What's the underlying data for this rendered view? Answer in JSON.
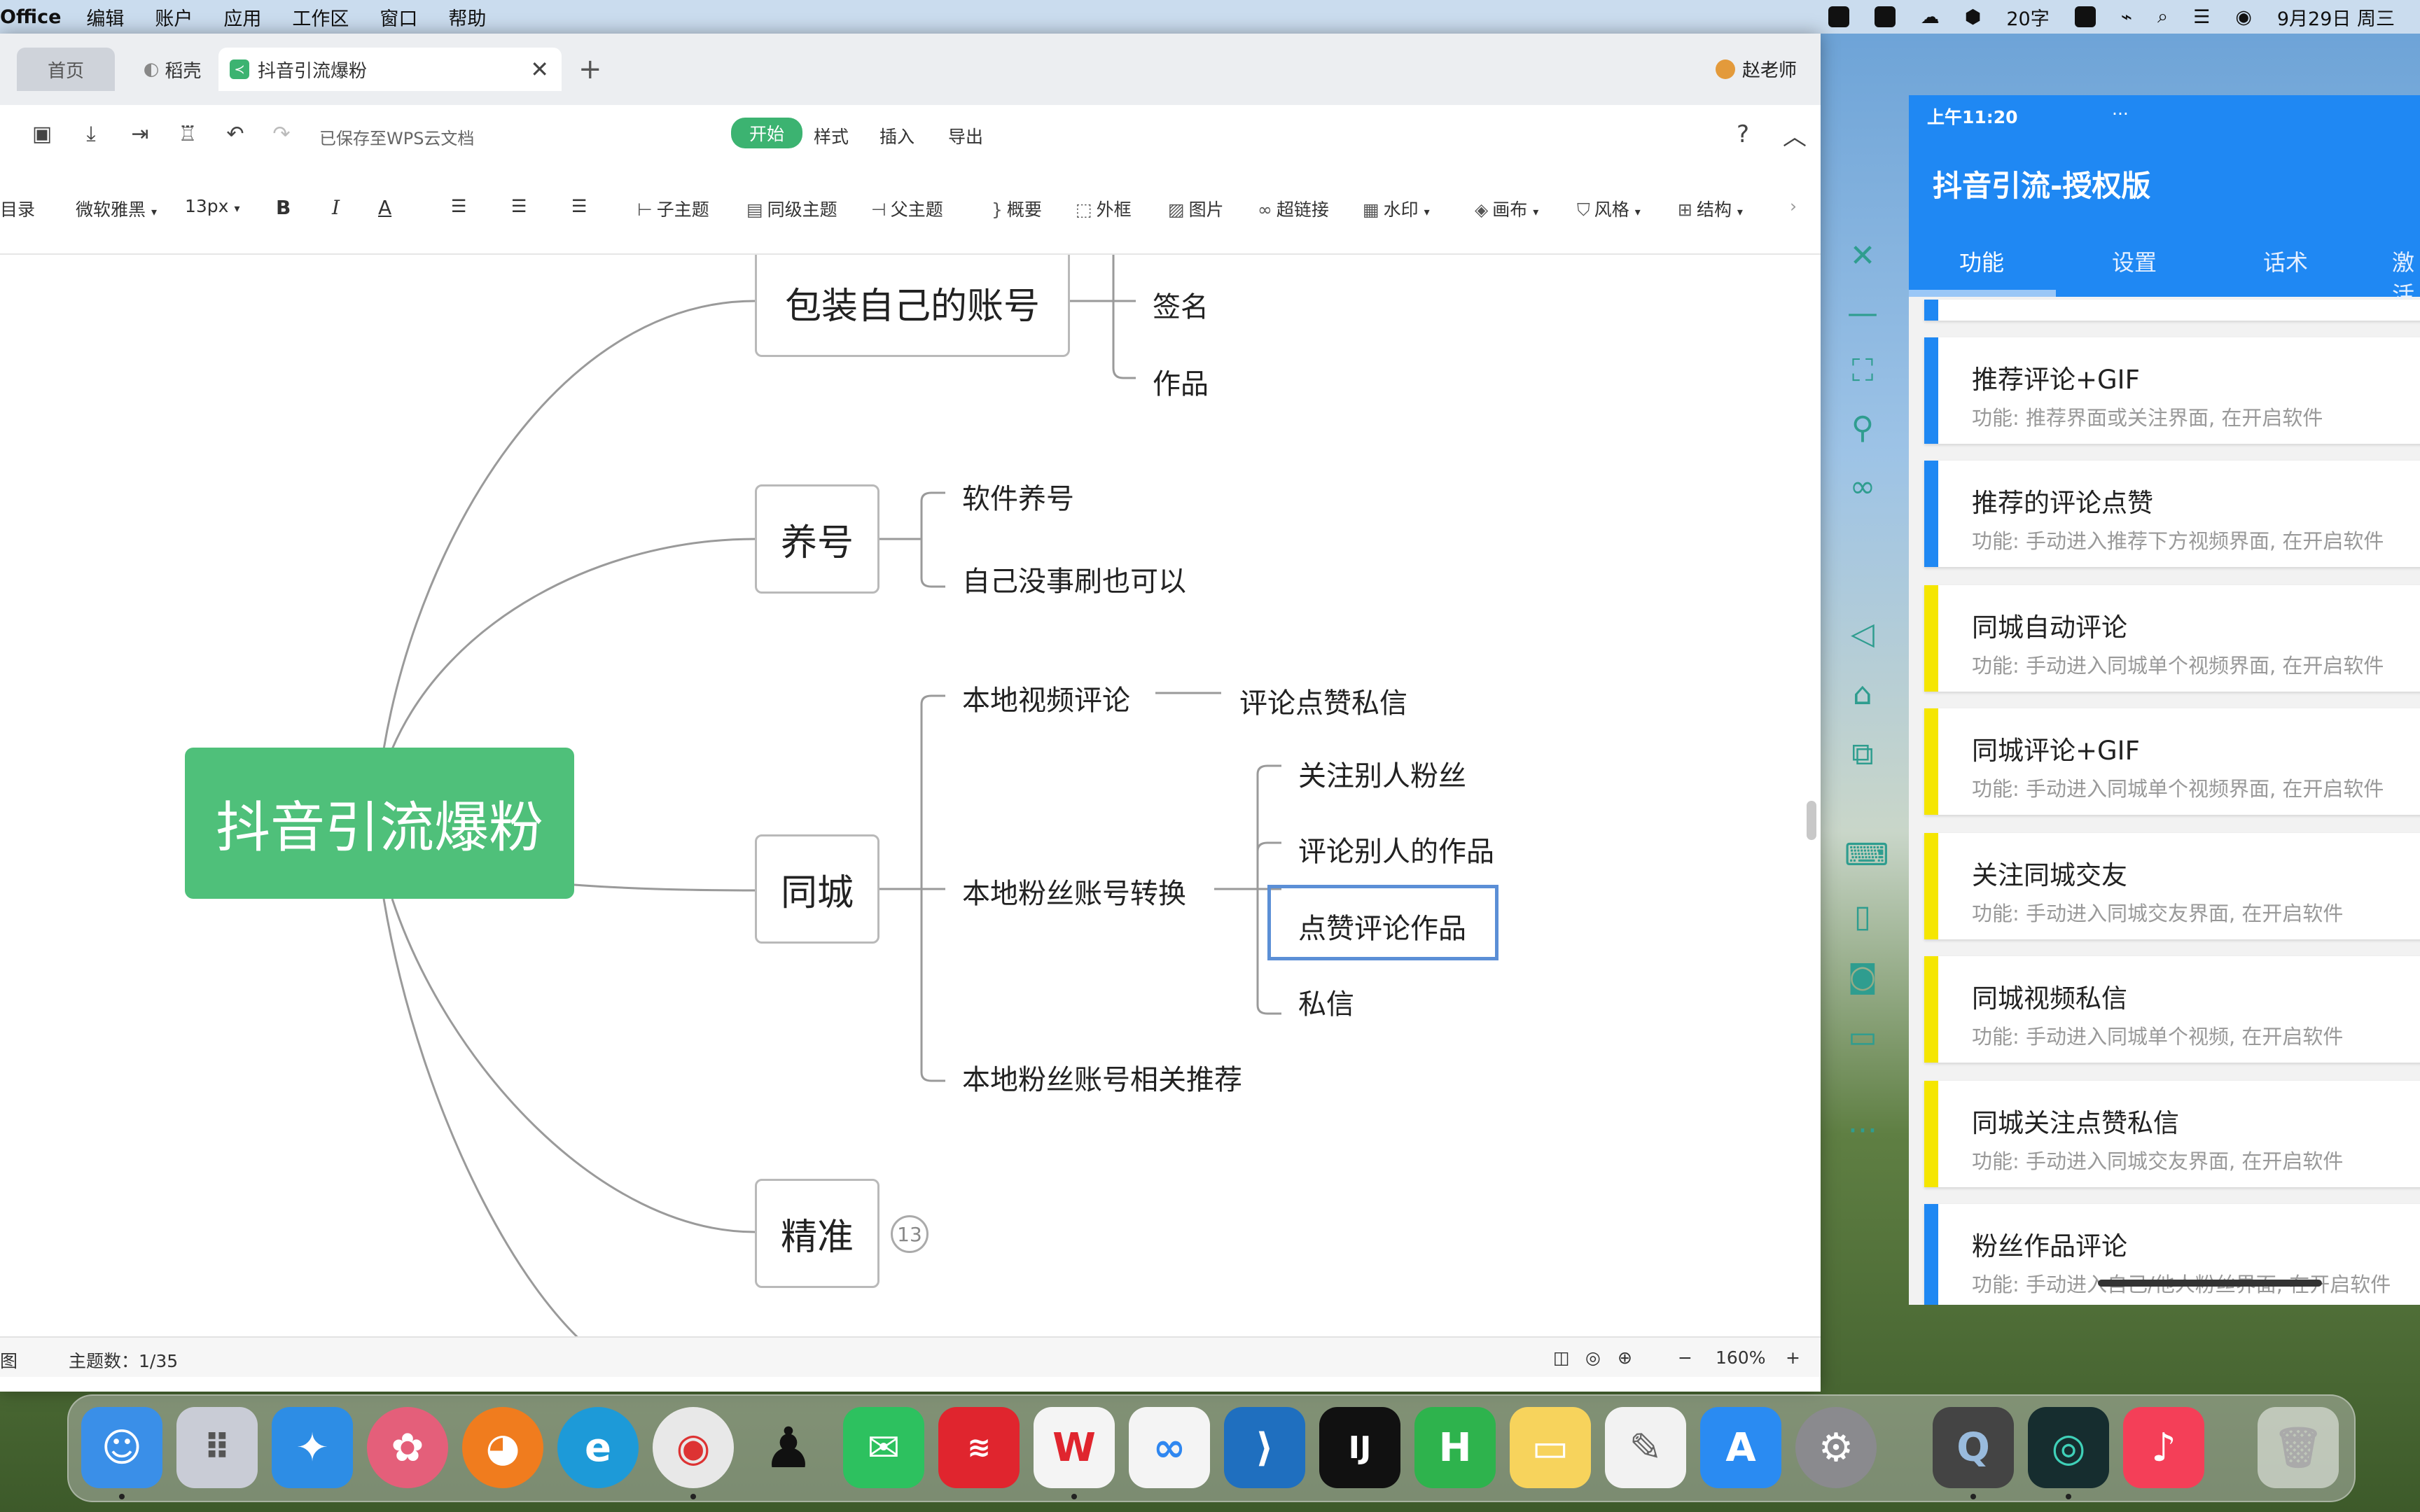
{
  "menubar": {
    "app": "Office",
    "items": [
      "编辑",
      "账户",
      "应用",
      "工作区",
      "窗口",
      "帮助"
    ],
    "status": {
      "word_count": "20字",
      "date": "9月29日 周三"
    }
  },
  "tabs": {
    "home": "首页",
    "daoke": "稻壳",
    "doc": "抖音引流爆粉",
    "doc_icon": "mindmap-icon",
    "user": "赵老师"
  },
  "toolbar1": {
    "save_status": "已保存至WPS云文档",
    "menu_start": "开始",
    "menu_style": "样式",
    "menu_insert": "插入",
    "menu_export": "导出"
  },
  "toolbar2": {
    "outline": "目录",
    "font": "微软雅黑",
    "font_size": "13px",
    "bold": "B",
    "italic": "I",
    "font_color": "A",
    "child_topic": "子主题",
    "sibling_topic": "同级主题",
    "parent_topic": "父主题",
    "summary": "概要",
    "frame": "外框",
    "image": "图片",
    "link": "超链接",
    "watermark": "水印",
    "canvas": "画布",
    "style": "风格",
    "structure": "结构"
  },
  "mindmap": {
    "root": "抖音引流爆粉",
    "branches": [
      {
        "label": "包装自己的账号",
        "children": [
          "签名",
          "作品"
        ]
      },
      {
        "label": "养号",
        "children": [
          "软件养号",
          "自己没事刷也可以"
        ]
      },
      {
        "label": "同城",
        "children": [
          {
            "label": "本地视频评论",
            "children": [
              "评论点赞私信"
            ]
          },
          {
            "label": "本地粉丝账号转换",
            "children": [
              "关注别人粉丝",
              "评论别人的作品",
              "点赞评论作品",
              "私信"
            ]
          },
          {
            "label": "本地粉丝账号相关推荐"
          }
        ]
      },
      {
        "label": "精准",
        "collapsed_count": "13"
      }
    ],
    "selected": "点赞评论作品"
  },
  "statusbar": {
    "view": "图",
    "topic_count": "主题数：1/35",
    "zoom": "160%",
    "minus": "−",
    "plus": "+"
  },
  "phone": {
    "time": "上午11:20",
    "more": "···",
    "title": "抖音引流-授权版",
    "tabs": [
      "功能",
      "设置",
      "话术",
      "激活"
    ],
    "cards": [
      {
        "title": "推荐评论+GIF",
        "desc": "功能: 推荐界面或关注界面, 在开启软件",
        "color": "#1f88f3"
      },
      {
        "title": "推荐的评论点赞",
        "desc": "功能: 手动进入推荐下方视频界面, 在开启软件",
        "color": "#1f88f3"
      },
      {
        "title": "同城自动评论",
        "desc": "功能: 手动进入同城单个视频界面, 在开启软件",
        "color": "#f5e600"
      },
      {
        "title": "同城评论+GIF",
        "desc": "功能: 手动进入同城单个视频界面, 在开启软件",
        "color": "#f5e600"
      },
      {
        "title": "关注同城交友",
        "desc": "功能: 手动进入同城交友界面, 在开启软件",
        "color": "#f5e600"
      },
      {
        "title": "同城视频私信",
        "desc": "功能: 手动进入同城单个视频, 在开启软件",
        "color": "#f5e600"
      },
      {
        "title": "同城关注点赞私信",
        "desc": "功能: 手动进入同城交友界面, 在开启软件",
        "color": "#f5e600"
      },
      {
        "title": "粉丝作品评论",
        "desc": "功能: 手动进入自己/他人粉丝界面, 在开启软件",
        "color": "#1f88f3"
      }
    ]
  },
  "colors": {
    "accent_green": "#4fc07a",
    "phone_blue": "#1f88f3",
    "selected_border": "#5b8fd6"
  }
}
